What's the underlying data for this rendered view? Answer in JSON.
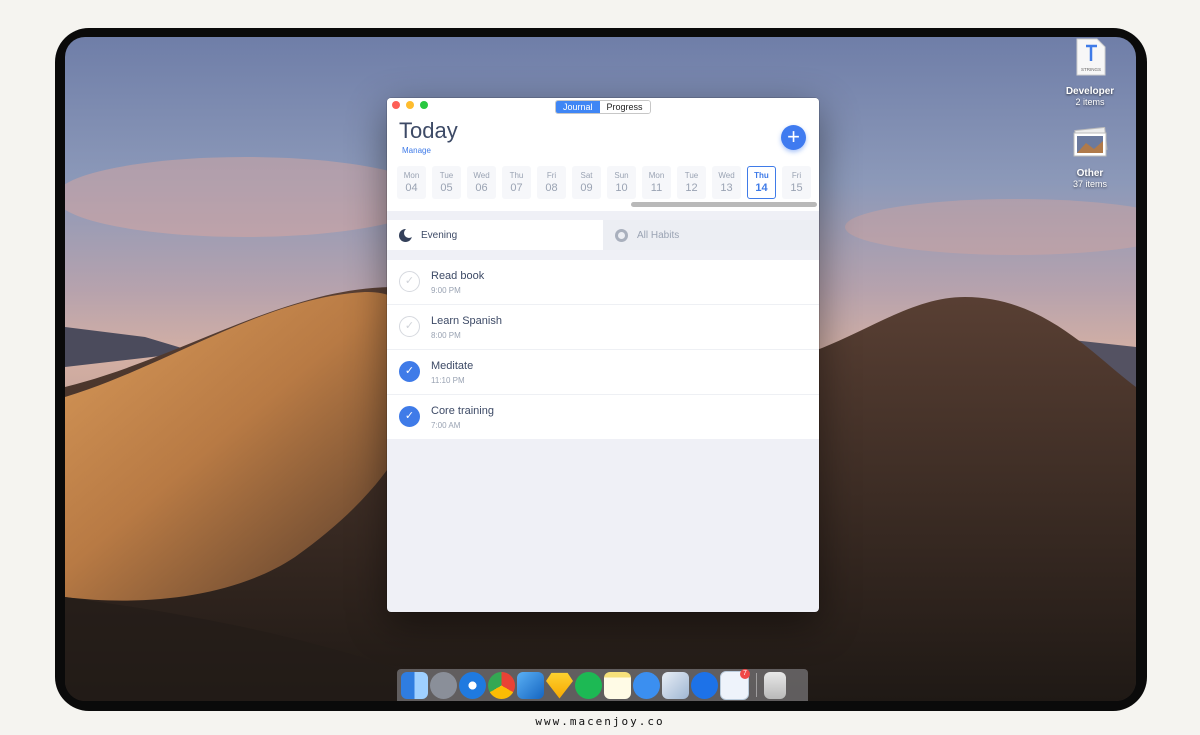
{
  "window": {
    "segments": [
      {
        "label": "Journal",
        "active": true
      },
      {
        "label": "Progress",
        "active": false
      }
    ],
    "title": "Today",
    "manage_label": "Manage",
    "add_label": "+",
    "days": [
      {
        "weekday": "Mon",
        "date": "04",
        "selected": false
      },
      {
        "weekday": "Tue",
        "date": "05",
        "selected": false
      },
      {
        "weekday": "Wed",
        "date": "06",
        "selected": false
      },
      {
        "weekday": "Thu",
        "date": "07",
        "selected": false
      },
      {
        "weekday": "Fri",
        "date": "08",
        "selected": false
      },
      {
        "weekday": "Sat",
        "date": "09",
        "selected": false
      },
      {
        "weekday": "Sun",
        "date": "10",
        "selected": false
      },
      {
        "weekday": "Mon",
        "date": "11",
        "selected": false
      },
      {
        "weekday": "Tue",
        "date": "12",
        "selected": false
      },
      {
        "weekday": "Wed",
        "date": "13",
        "selected": false
      },
      {
        "weekday": "Thu",
        "date": "14",
        "selected": true
      },
      {
        "weekday": "Fri",
        "date": "15",
        "selected": false
      }
    ],
    "tabs": {
      "evening": "Evening",
      "all_habits": "All Habits"
    },
    "habits": [
      {
        "name": "Read book",
        "time": "9:00 PM",
        "done": false
      },
      {
        "name": "Learn Spanish",
        "time": "8:00 PM",
        "done": false
      },
      {
        "name": "Meditate",
        "time": "11:10 PM",
        "done": true
      },
      {
        "name": "Core training",
        "time": "7:00 AM",
        "done": true
      }
    ]
  },
  "desktop": {
    "icons": [
      {
        "name": "Developer",
        "count": "2 items",
        "label_on_icon": "STRINGS"
      },
      {
        "name": "Other",
        "count": "37 items"
      }
    ]
  },
  "dock": {
    "apps": [
      "finder-icon",
      "launchpad-icon",
      "safari-icon",
      "chrome-icon",
      "xcode-icon",
      "sketch-icon",
      "spotify-icon",
      "notes-icon",
      "messages-icon",
      "preview-icon",
      "tasks-icon",
      "app-icon"
    ],
    "badge": "7"
  },
  "watermark": "www.macenjoy.co",
  "colors": {
    "accent": "#3f7be8",
    "title_text": "#3d4a66",
    "muted_text": "#9aa3b3"
  }
}
